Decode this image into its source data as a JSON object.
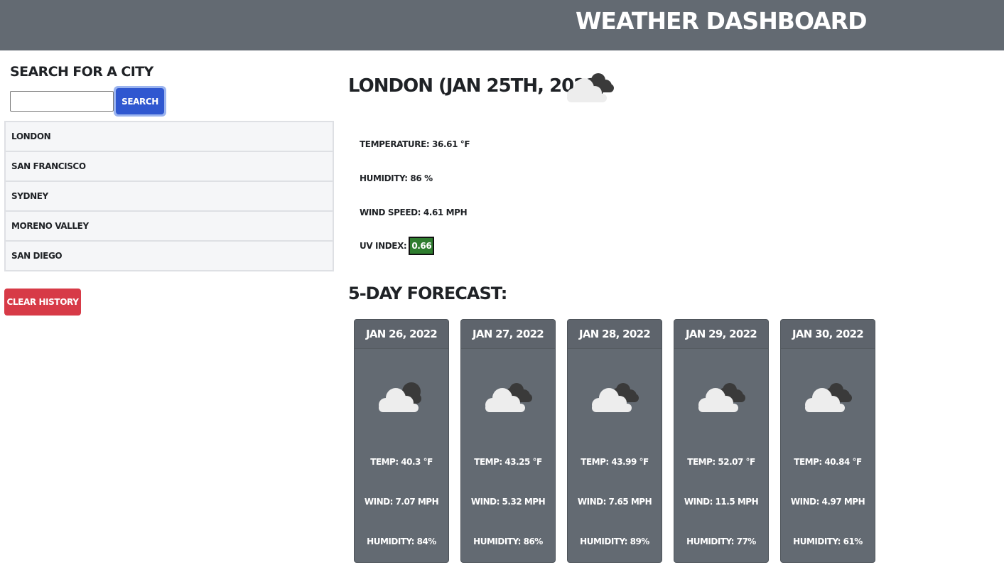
{
  "header": {
    "title": "Weather Dashboard"
  },
  "sidebar": {
    "title": "Search for a City",
    "search": {
      "value": "",
      "placeholder": "",
      "button_label": "Search"
    },
    "history": [
      "London",
      "San Francisco",
      "Sydney",
      "Moreno Valley",
      "San Diego"
    ],
    "clear_label": "Clear History"
  },
  "current": {
    "title": "London (Jan 25th, 2022)",
    "icon": "broken-clouds-icon",
    "temperature": "Temperature: 36.61 °F",
    "humidity": "Humidity: 86 %",
    "wind": "Wind Speed: 4.61 MPH",
    "uv_label": "UV Index:",
    "uv_value": "0.66",
    "uv_color": "#2f7d2f"
  },
  "forecast": {
    "title": "5-Day Forecast:",
    "days": [
      {
        "date": "Jan 26, 2022",
        "icon": "cloud-icon",
        "temp": "Temp: 40.3 °F",
        "wind": "Wind: 7.07 MPH",
        "humidity": "Humidity: 84%"
      },
      {
        "date": "Jan 27, 2022",
        "icon": "broken-clouds-icon",
        "temp": "Temp: 43.25 °F",
        "wind": "Wind: 5.32 MPH",
        "humidity": "Humidity: 86%"
      },
      {
        "date": "Jan 28, 2022",
        "icon": "broken-clouds-icon",
        "temp": "Temp: 43.99 °F",
        "wind": "Wind: 7.65 MPH",
        "humidity": "Humidity: 89%"
      },
      {
        "date": "Jan 29, 2022",
        "icon": "broken-clouds-icon",
        "temp": "Temp: 52.07 °F",
        "wind": "Wind: 11.5 MPH",
        "humidity": "Humidity: 77%"
      },
      {
        "date": "Jan 30, 2022",
        "icon": "broken-clouds-icon",
        "temp": "Temp: 40.84 °F",
        "wind": "Wind: 4.97 MPH",
        "humidity": "Humidity: 61%"
      }
    ]
  },
  "colors": {
    "header_bg": "#636a72",
    "search_button": "#2f57d0",
    "clear_button": "#d73a47",
    "card_bg": "#636a72"
  }
}
